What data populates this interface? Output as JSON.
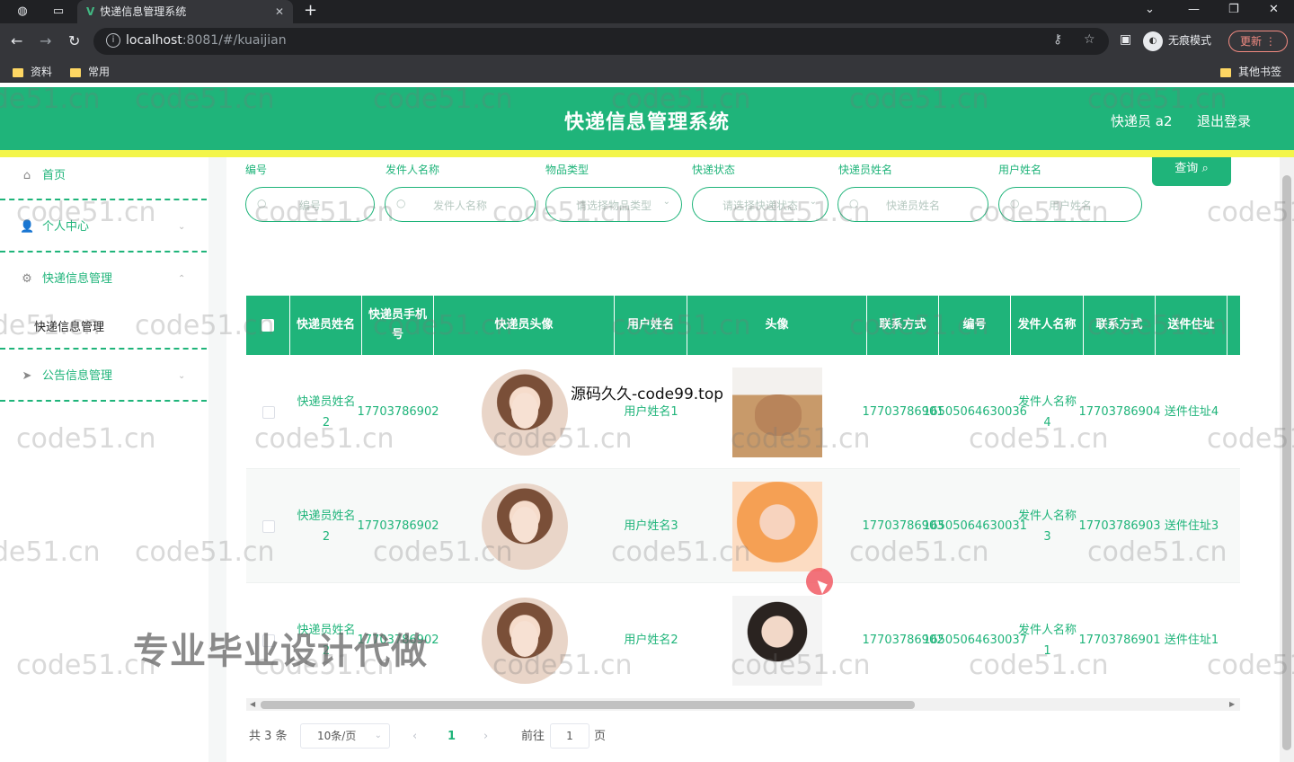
{
  "browser": {
    "tab_title": "快递信息管理系统",
    "new_tab_symbol": "+",
    "url_host": "localhost",
    "url_rest": ":8081/#/kuaijian",
    "incognito_label": "无痕模式",
    "update_label": "更新",
    "bookmarks": [
      "资料",
      "常用"
    ],
    "other_bookmarks": "其他书签"
  },
  "header": {
    "title": "快递信息管理系统",
    "user": "快递员 a2",
    "logout": "退出登录"
  },
  "sidebar": {
    "items": [
      {
        "label": "首页",
        "icon": "home-icon"
      },
      {
        "label": "个人中心",
        "icon": "user-icon"
      },
      {
        "label": "快递信息管理",
        "icon": "gear-icon"
      },
      {
        "label": "公告信息管理",
        "icon": "send-icon"
      }
    ],
    "sub_item": "快递信息管理"
  },
  "filters": {
    "labels": [
      "编号",
      "发件人名称",
      "物品类型",
      "快递状态",
      "快递员姓名",
      "用户姓名"
    ],
    "placeholders": [
      "编号",
      "发件人名称",
      "请选择物品类型",
      "请选择快递状态",
      "快递员姓名",
      "用户姓名"
    ],
    "search_button": "查询"
  },
  "table": {
    "headers": [
      "快递员姓名",
      "快递员手机号",
      "快递员头像",
      "用户姓名",
      "头像",
      "联系方式",
      "编号",
      "发件人名称",
      "联系方式",
      "送件住址"
    ],
    "rows": [
      {
        "courier_name": "快递员姓名2",
        "courier_phone": "17703786902",
        "user_name": "用户姓名1",
        "contact": "17703786901",
        "number": "16505064630036",
        "sender": "发件人名称4",
        "contact2": "17703786904",
        "address": "送件住址4",
        "photo": "cat"
      },
      {
        "courier_name": "快递员姓名2",
        "courier_phone": "17703786902",
        "user_name": "用户姓名3",
        "contact": "17703786903",
        "number": "16505064630031",
        "sender": "发件人名称3",
        "contact2": "17703786903",
        "address": "送件住址3",
        "photo": "girl"
      },
      {
        "courier_name": "快递员姓名2",
        "courier_phone": "17703786902",
        "user_name": "用户姓名2",
        "contact": "17703786902",
        "number": "16505064630037",
        "sender": "发件人名称1",
        "contact2": "17703786901",
        "address": "送件住址1",
        "photo": "boy"
      }
    ]
  },
  "pagination": {
    "total": "共 3 条",
    "page_size": "10条/页",
    "current_page": "1",
    "goto_label": "前往",
    "goto_value": "1",
    "page_unit": "页"
  },
  "overlays": {
    "watermark": "code51.cn",
    "promo": "专业毕业设计代做",
    "source": "源码久久-code99.top"
  },
  "colors": {
    "accent": "#1fb47a",
    "strip": "#f3f54a"
  }
}
